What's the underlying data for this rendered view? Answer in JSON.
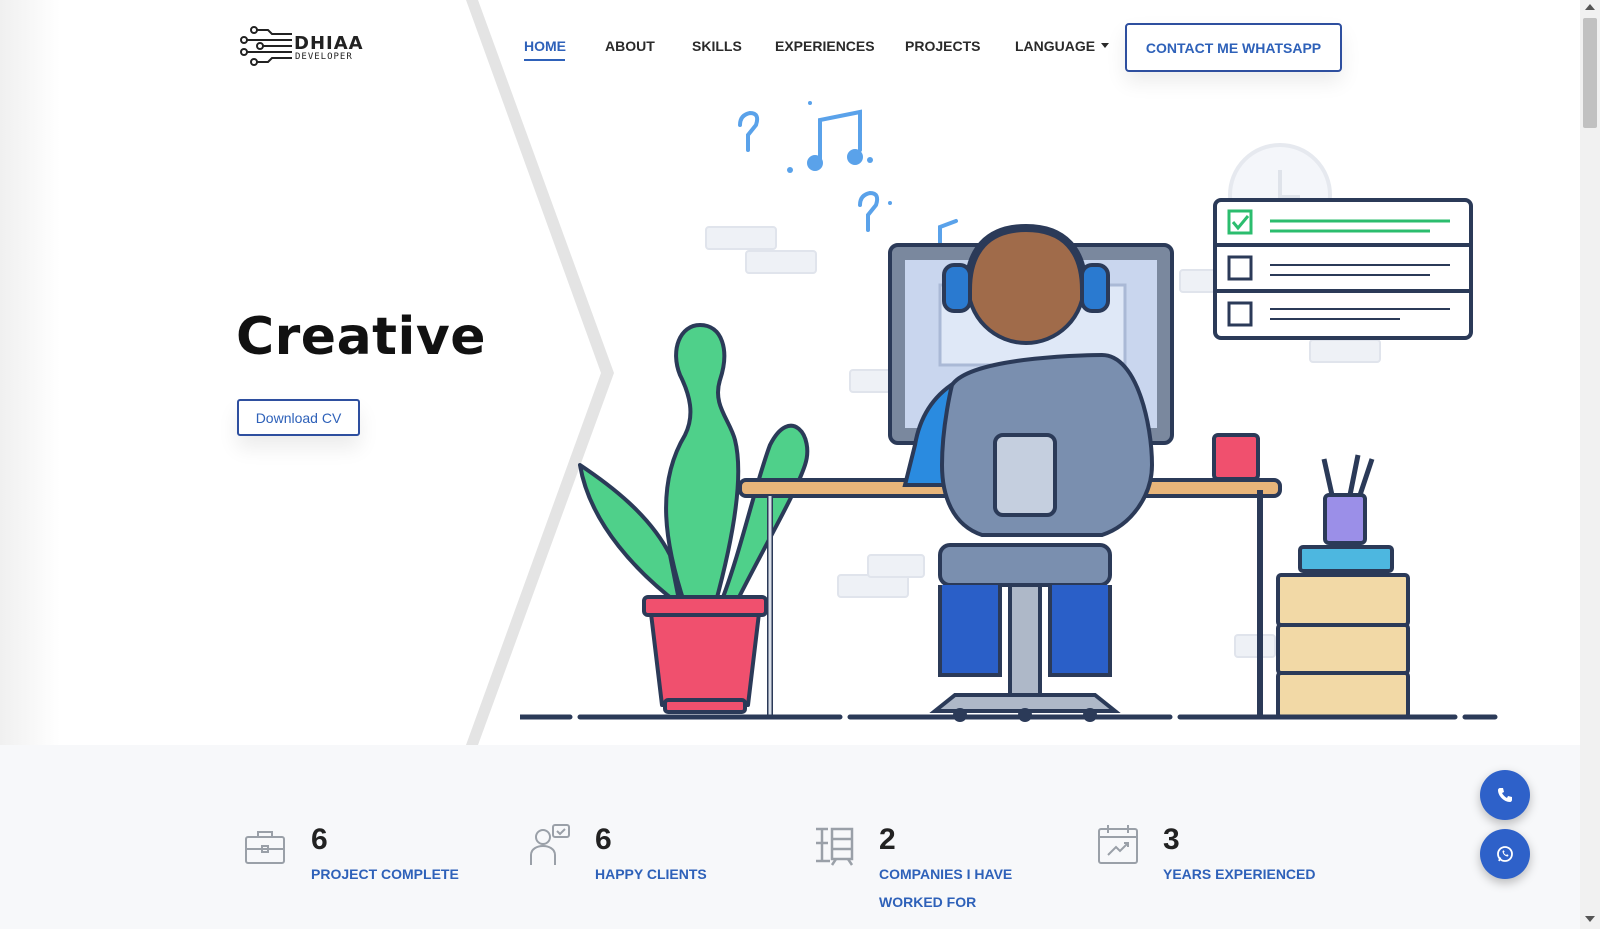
{
  "logo": {
    "main": "DHIAA",
    "sub": "DEVELOPER"
  },
  "nav": {
    "items": [
      "HOME",
      "ABOUT",
      "SKILLS",
      "EXPERIENCES",
      "PROJECTS",
      "LANGUAGE"
    ],
    "active": "HOME",
    "contact_label": "CONTACT ME WHATSAPP"
  },
  "hero": {
    "title": "Creative",
    "cv_button": "Download CV"
  },
  "stats": [
    {
      "number": "6",
      "label": "PROJECT COMPLETE",
      "icon": "briefcase-icon"
    },
    {
      "number": "6",
      "label": "HAPPY CLIENTS",
      "icon": "client-icon"
    },
    {
      "number": "2",
      "label": "COMPANIES I HAVE WORKED FOR",
      "icon": "company-icon"
    },
    {
      "number": "3",
      "label": "YEARS EXPERIENCED",
      "icon": "calendar-chart-icon"
    }
  ],
  "floating": {
    "phone_icon": "phone-icon",
    "whatsapp_icon": "whatsapp-icon"
  },
  "colors": {
    "accent": "#2e61b9",
    "band": "#f7f8fa",
    "plant": "#4fd08a",
    "pot": "#f0506e"
  }
}
